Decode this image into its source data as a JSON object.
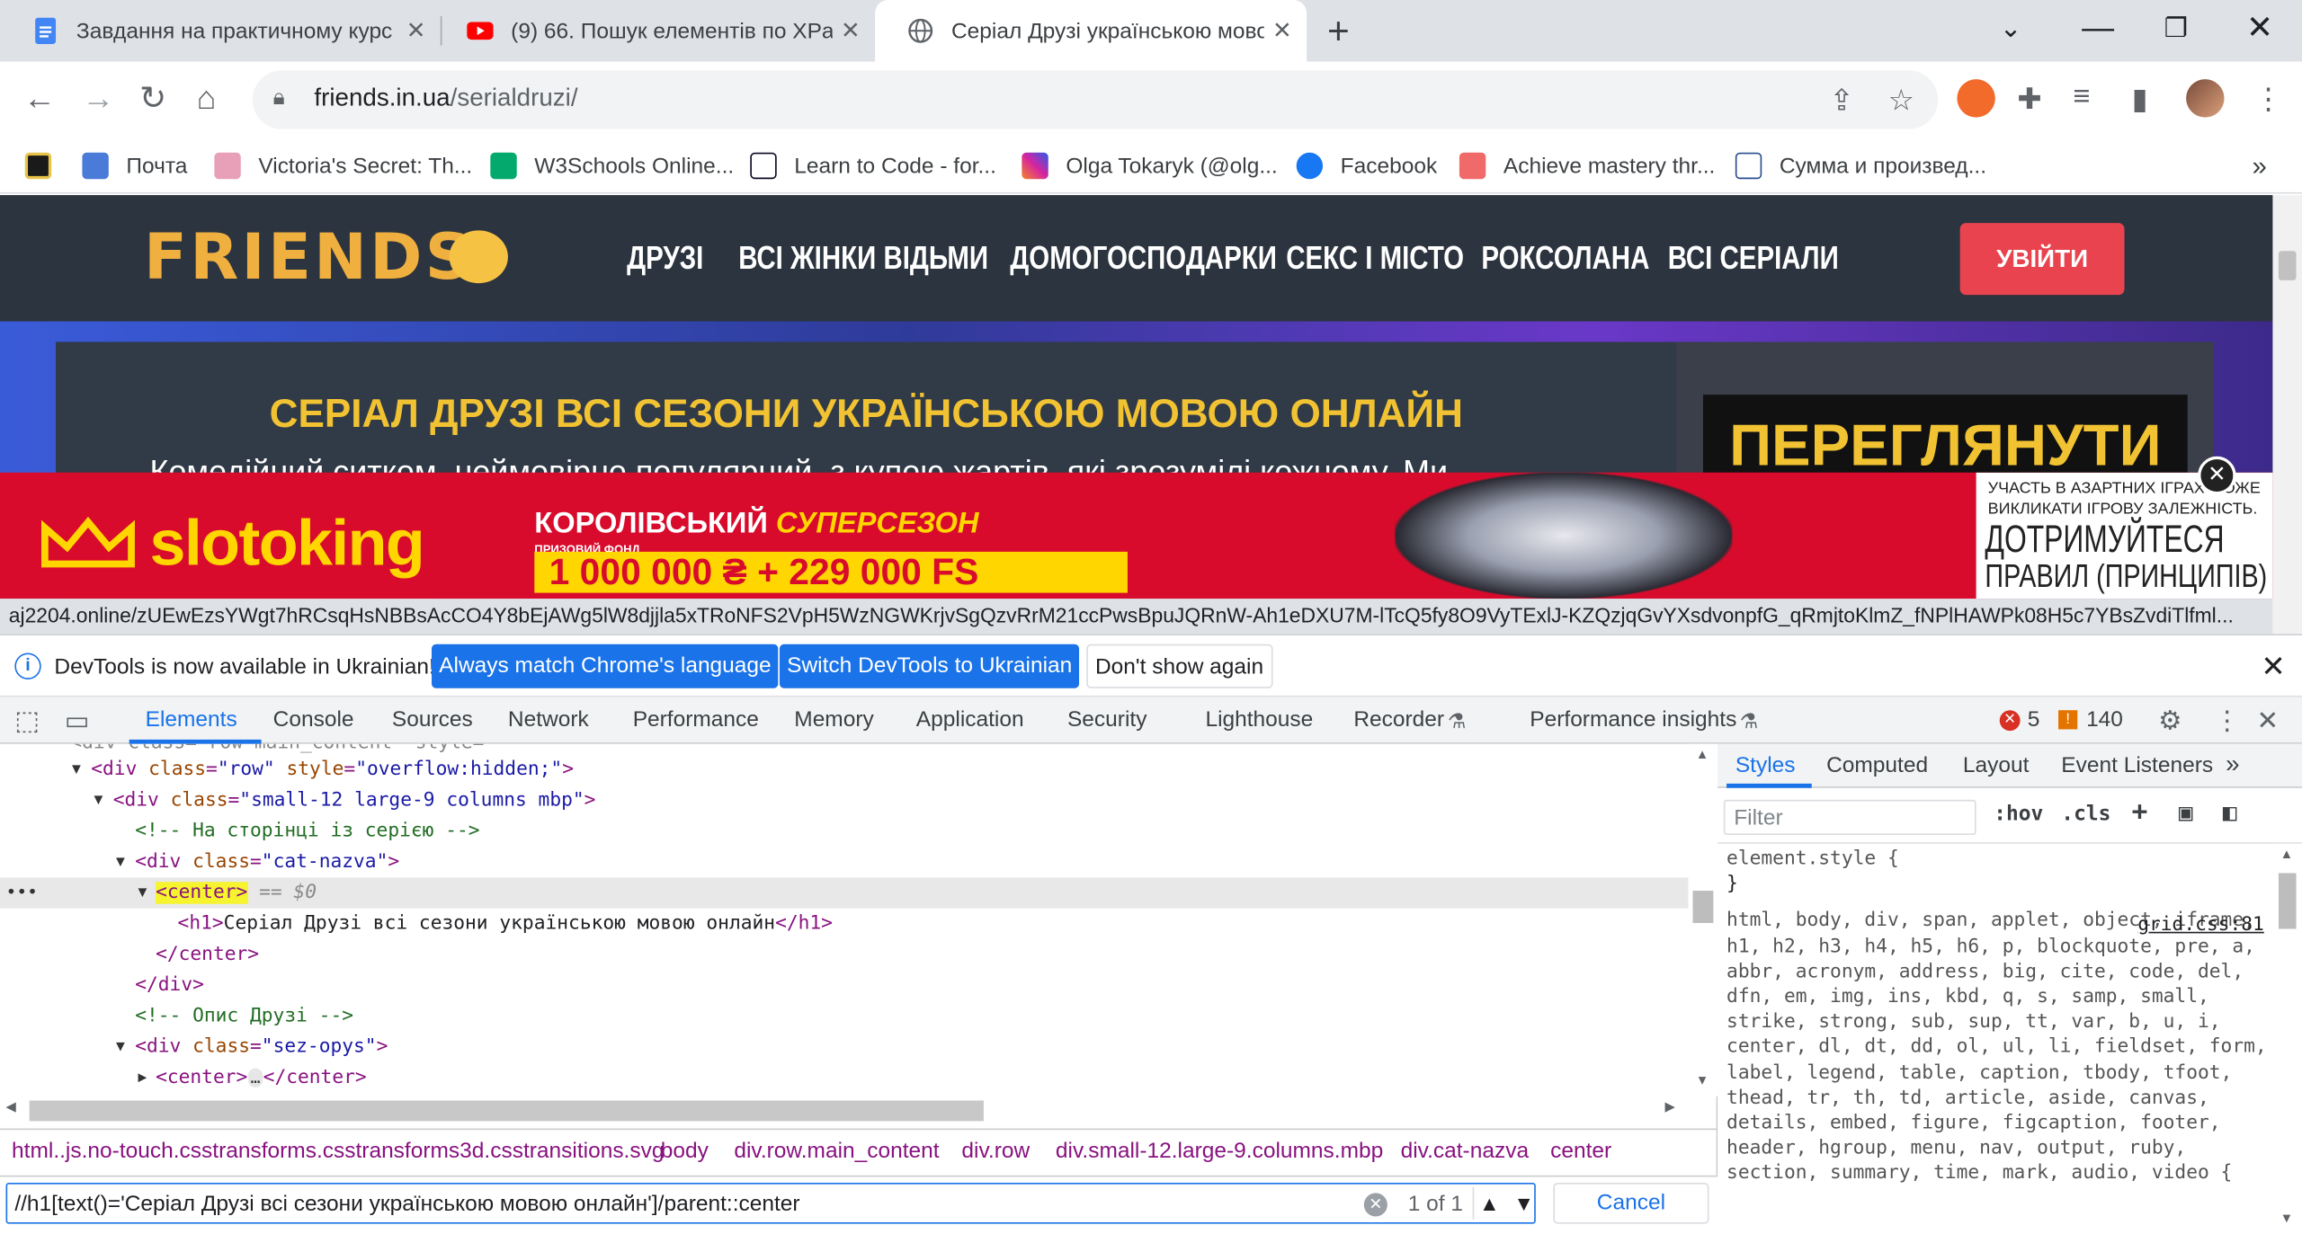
{
  "browser": {
    "tabs": [
      {
        "title": "Завдання на практичному курс",
        "icon": "google-docs-icon"
      },
      {
        "title": "(9) 66. Пошук елементів по XPa",
        "icon": "youtube-icon"
      },
      {
        "title": "Серіал Друзі українською мово",
        "icon": "globe-icon"
      }
    ],
    "url_domain": "friends.in.ua",
    "url_path": "/serialdruzi/",
    "bookmarks": [
      {
        "label": "",
        "color": "#1a1a1a"
      },
      {
        "label": "Почта",
        "color": "#4a7bd8"
      },
      {
        "label": "Victoria's Secret: Th...",
        "color": "#e8a0b8"
      },
      {
        "label": "W3Schools Online...",
        "color": "#04aa6d"
      },
      {
        "label": "Learn to Code - for...",
        "color": "#0a0a23"
      },
      {
        "label": "Olga Tokaryk (@olg...",
        "color": "#d6249f"
      },
      {
        "label": "Facebook",
        "color": "#1877f2"
      },
      {
        "label": "Achieve mastery thr...",
        "color": "#f06a6a"
      },
      {
        "label": "Сумма и произвед...",
        "color": "#2a4d8f"
      }
    ]
  },
  "site": {
    "logo": "FRIENDS",
    "nav": [
      "ДРУЗІ",
      "ВСІ ЖІНКИ ВІДЬМИ",
      "ДОМОГОСПОДАРКИ",
      "СЕКС І МІСТО",
      "РОКСОЛАНА",
      "ВСІ СЕРІАЛИ"
    ],
    "login": "УВІЙТИ",
    "hero_title": "СЕРІАЛ ДРУЗІ ВСІ СЕЗОНИ УКРАЇНСЬКОЮ МОВОЮ ОНЛАЙН",
    "hero_desc": "Комедійний ситком, неймовірно популярний, з купою жартів, які зрозумілі кожному. Ми",
    "watch_button": "ПЕРЕГЛЯНУТИ"
  },
  "ad": {
    "brand": "slotoking",
    "line1_a": "КОРОЛІВСЬКИЙ",
    "line1_b": "СУПЕРСЕЗОН",
    "prize_label": "ПРИЗОВИЙ ФОНД",
    "prize": "1 000 000 ₴ + 229 000 FS",
    "side_small": "УЧАСТЬ В АЗАРТНИХ ІГРАХ МОЖЕ ВИКЛИКАТИ ІГРОВУ ЗАЛЕЖНІСТЬ.",
    "side_big1": "ДОТРИМУЙТЕСЯ",
    "side_big2": "ПРАВИЛ (ПРИНЦИПІВ)"
  },
  "status_url": "aj2204.online/zUEwEzsYWgt7hRCsqHsNBBsAcCO4Y8bEjAWg5lW8djjla5xTRoNFS2VpH5WzNGWKrjvSgQzvRrM21ccPwsBpuJQRnW-Ah1eDXU7M-lTcQ5fy8O9VyTExlJ-KZQzjqGvYXsdvonpfG_qRmjtoKlmZ_fNPlHAWPk08H5c7YBsZvdiTlfml...",
  "devtools": {
    "info_text": "DevTools is now available in Ukrainian!",
    "btn_match": "Always match Chrome's language",
    "btn_switch": "Switch DevTools to Ukrainian",
    "btn_dont": "Don't show again",
    "tabs": [
      "Elements",
      "Console",
      "Sources",
      "Network",
      "Performance",
      "Memory",
      "Application",
      "Security",
      "Lighthouse",
      "Recorder",
      "Performance insights"
    ],
    "errors": "5",
    "warnings": "140",
    "dom": {
      "l0": "<div class=\"row main_content\" style=\"",
      "l1_tag": "div",
      "l1_attr": "class",
      "l1_val": "\"row\"",
      "l1_attr2": "style",
      "l1_val2": "\"overflow:hidden;\"",
      "l2_val": "\"small-12 large-9 columns mbp\"",
      "l3_comment": "<!-- На сторінці із серією -->",
      "l4_val": "\"cat-nazva\"",
      "l5_tag": "<center>",
      "l5_eq": "== $0",
      "l6_text": "Серіал Друзі всі сезони українською мовою онлайн",
      "l9_comment": "<!-- Опис Друзі -->",
      "l10_val": "\"sez-opys\"",
      "ellipsis": "…"
    },
    "breadcrumbs": [
      "html..js.no-touch.csstransforms.csstransforms3d.csstransitions.svg",
      "body",
      "div.row.main_content",
      "div.row",
      "div.small-12.large-9.columns.mbp",
      "div.cat-nazva",
      "center"
    ],
    "search_query": "//h1[text()='Серіал Друзі всі сезони українською мовою онлайн']/parent::center",
    "search_count": "1 of 1",
    "cancel": "Cancel",
    "styles_tabs": [
      "Styles",
      "Computed",
      "Layout",
      "Event Listeners"
    ],
    "filter_placeholder": "Filter",
    "hov": ":hov",
    "cls": ".cls",
    "element_style": "element.style {",
    "close_brace": "}",
    "css_source": "grid.css:81",
    "css_selector": "html, body, div, span, applet, object, iframe, h1, h2, h3, h4, h5, h6, p, blockquote, pre, a, abbr, acronym, address, big, cite, code, del, dfn, em, img, ins, kbd, q, s, samp, small, strike, strong, sub, sup, tt, var, b, u, i, center, dl, dt, dd, ol, ul, li, fieldset, form, label, legend, table, caption, tbody, tfoot, thead, tr, th, td, article, aside, canvas, details, embed, figure, figcaption, footer, header, hgroup, menu, nav, output, ruby, section, summary, time, mark, audio, video {"
  }
}
